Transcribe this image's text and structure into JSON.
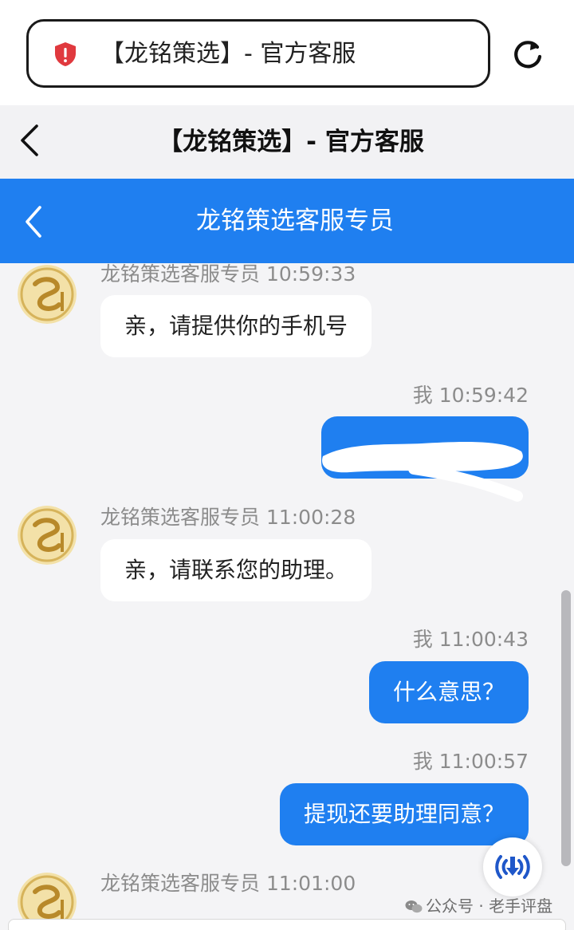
{
  "browser": {
    "address_text": "【龙铭策选】- 官方客服",
    "security_icon": "red-shield-alert-icon",
    "reload_icon": "reload-icon"
  },
  "page": {
    "title": "【龙铭策选】- 官方客服",
    "back_icon": "chevron-left-icon"
  },
  "chat": {
    "header_title": "龙铭策选客服专员",
    "accent_color": "#1f7ff0",
    "messages": [
      {
        "from": "agent",
        "meta": "龙铭策选客服专员 10:59:33",
        "text": "亲，请提供你的手机号"
      },
      {
        "from": "me",
        "meta": "我 10:59:42",
        "text": ""
      },
      {
        "from": "agent",
        "meta": "龙铭策选客服专员 11:00:28",
        "text": "亲，请联系您的助理。"
      },
      {
        "from": "me",
        "meta": "我 11:00:43",
        "text": "什么意思？"
      },
      {
        "from": "me",
        "meta": "我 11:00:57",
        "text": "提现还要助理同意？"
      },
      {
        "from": "agent",
        "meta": "龙铭策选客服专员 11:01:00",
        "text": ""
      }
    ]
  },
  "watermark": {
    "text": "公众号 · 老手评盘",
    "icon": "wechat-icon"
  }
}
